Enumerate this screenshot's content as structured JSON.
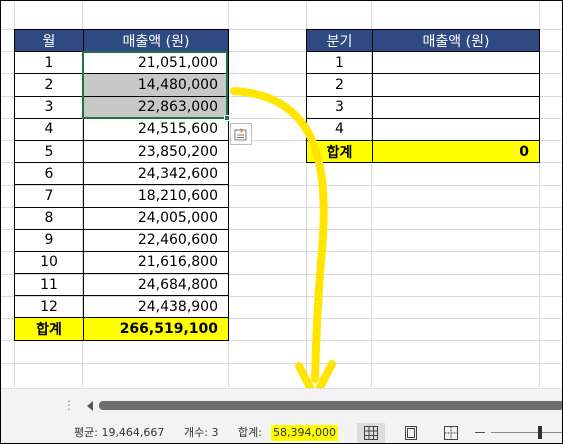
{
  "left_table": {
    "headers": [
      "월",
      "매출액 (원)"
    ],
    "rows": [
      {
        "month": "1",
        "amount": "21,051,000"
      },
      {
        "month": "2",
        "amount": "14,480,000"
      },
      {
        "month": "3",
        "amount": "22,863,000"
      },
      {
        "month": "4",
        "amount": "24,515,600"
      },
      {
        "month": "5",
        "amount": "23,850,200"
      },
      {
        "month": "6",
        "amount": "24,342,600"
      },
      {
        "month": "7",
        "amount": "18,210,600"
      },
      {
        "month": "8",
        "amount": "24,005,000"
      },
      {
        "month": "9",
        "amount": "22,460,600"
      },
      {
        "month": "10",
        "amount": "21,616,800"
      },
      {
        "month": "11",
        "amount": "24,684,800"
      },
      {
        "month": "12",
        "amount": "24,438,900"
      }
    ],
    "total_label": "합계",
    "total_value": "266,519,100"
  },
  "right_table": {
    "headers": [
      "분기",
      "매출액 (원)"
    ],
    "rows": [
      {
        "quarter": "1",
        "amount": ""
      },
      {
        "quarter": "2",
        "amount": ""
      },
      {
        "quarter": "3",
        "amount": ""
      },
      {
        "quarter": "4",
        "amount": ""
      }
    ],
    "total_label": "합계",
    "total_value": "0"
  },
  "scrollbar": {
    "sheet_options": "⋮"
  },
  "status_bar": {
    "average": "평균:  19,464,667",
    "count": "개수: 3",
    "sum_label": "합계:",
    "sum_value": "58,394,000",
    "highlight_color": "#ffff00"
  },
  "colors": {
    "header_bg": "#2f4a82",
    "total_bg": "#ffff00",
    "selected_cell_bg": "#c8c8c8",
    "selection_border": "#217346",
    "annotation_arrow": "#ffe500"
  },
  "icons": {
    "quick_analysis": "quick-analysis-icon",
    "view_normal": "normal-view-icon",
    "view_layout": "page-layout-view-icon",
    "view_break": "page-break-preview-icon"
  }
}
